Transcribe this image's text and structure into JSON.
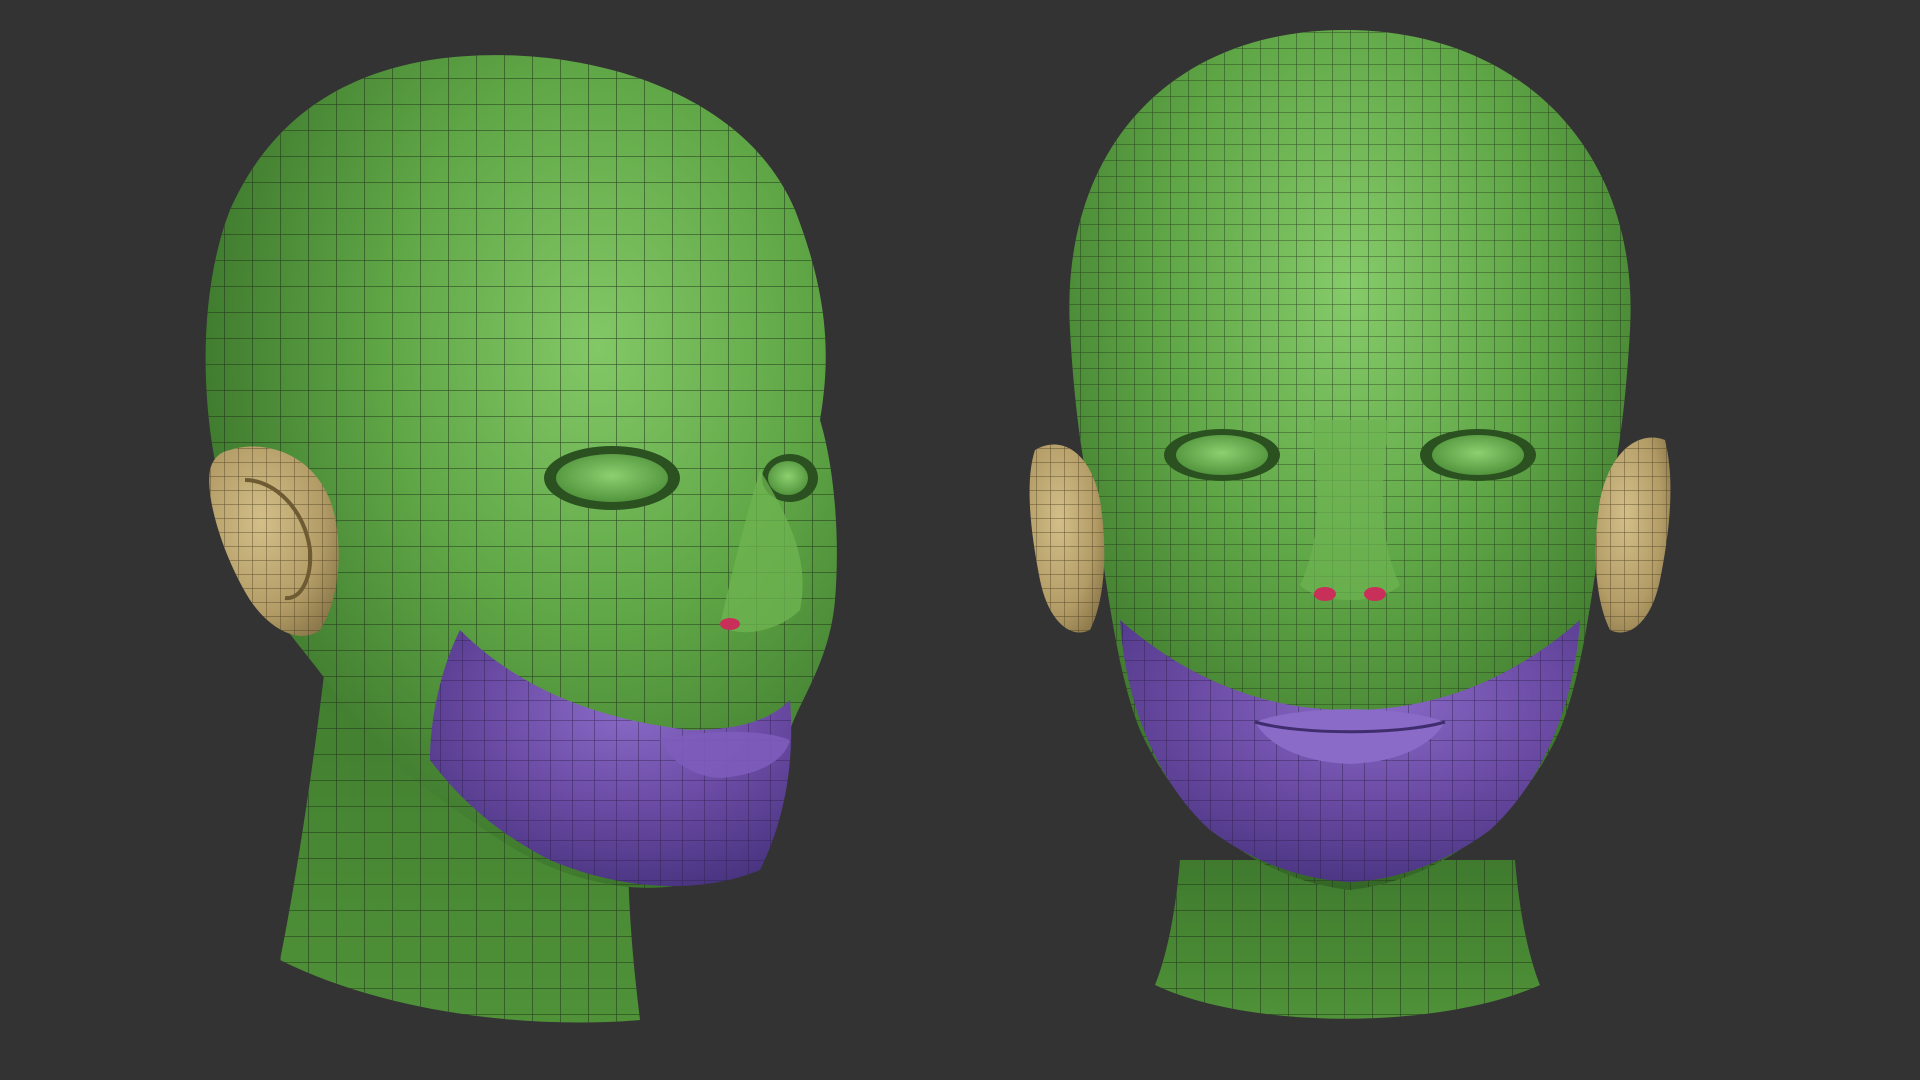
{
  "scene": {
    "background_color": "#333333",
    "models": [
      {
        "name": "head-three-quarter-view",
        "polygroups": [
          {
            "name": "head",
            "color": "#5c9e45"
          },
          {
            "name": "lower-face",
            "color": "#6a4aa3"
          },
          {
            "name": "ear",
            "color": "#b8a26c"
          },
          {
            "name": "nostril",
            "color": "#c8305a"
          }
        ]
      },
      {
        "name": "head-front-view",
        "polygroups": [
          {
            "name": "head",
            "color": "#5c9e45"
          },
          {
            "name": "lower-face",
            "color": "#6a4aa3"
          },
          {
            "name": "ear",
            "color": "#b8a26c"
          },
          {
            "name": "nostril",
            "color": "#c8305a"
          }
        ]
      }
    ],
    "wireframe_color": "#1e2f18"
  }
}
